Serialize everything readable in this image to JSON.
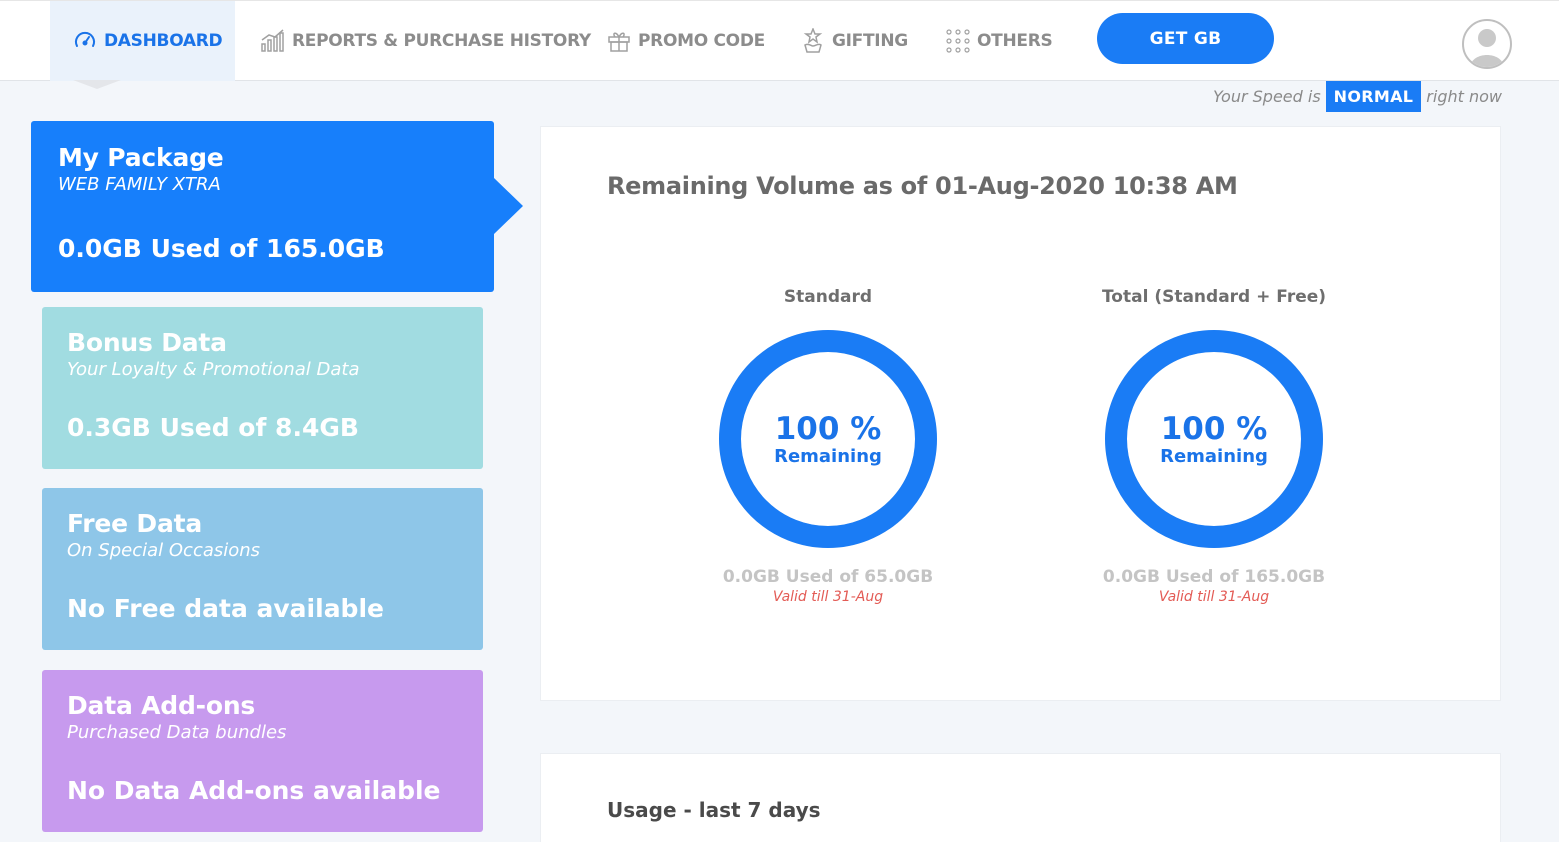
{
  "nav": {
    "items": [
      {
        "label": "DASHBOARD",
        "icon": "speedometer-icon"
      },
      {
        "label": "REPORTS & PURCHASE HISTORY",
        "icon": "bar-chart-icon"
      },
      {
        "label": "PROMO CODE",
        "icon": "gift-icon"
      },
      {
        "label": "GIFTING",
        "icon": "hand-star-icon"
      },
      {
        "label": "OTHERS",
        "icon": "grid-dots-icon"
      }
    ],
    "cta": "GET GB",
    "avatar_icon": "user-avatar-icon"
  },
  "speed": {
    "prefix": "Your Speed is",
    "status": "NORMAL",
    "suffix": "right now"
  },
  "cards": {
    "package": {
      "title": "My Package",
      "subtitle": "WEB FAMILY XTRA",
      "value": "0.0GB Used of 165.0GB",
      "color": "#177ffb"
    },
    "bonus": {
      "title": "Bonus Data",
      "subtitle": "Your Loyalty & Promotional Data",
      "value": "0.3GB Used of 8.4GB",
      "color": "#a1dce1"
    },
    "free": {
      "title": "Free Data",
      "subtitle": "On Special Occasions",
      "value": "No Free data available",
      "color": "#8ec6e8"
    },
    "addons": {
      "title": "Data Add-ons",
      "subtitle": "Purchased Data bundles",
      "value": "No Data Add-ons available",
      "color": "#c79aee"
    }
  },
  "remaining": {
    "title": "Remaining Volume as of 01-Aug-2020 10:38 AM",
    "rings": [
      {
        "label": "Standard",
        "percent_text": "100 %",
        "percent": 100,
        "sub": "Remaining",
        "used": "0.0GB Used of 65.0GB",
        "valid": "Valid till 31-Aug"
      },
      {
        "label": "Total (Standard + Free)",
        "percent_text": "100 %",
        "percent": 100,
        "sub": "Remaining",
        "used": "0.0GB Used of 165.0GB",
        "valid": "Valid till 31-Aug"
      }
    ]
  },
  "usage": {
    "title": "Usage - last 7 days"
  },
  "colors": {
    "accent": "#1a7cf5",
    "warning": "#e35b55"
  }
}
